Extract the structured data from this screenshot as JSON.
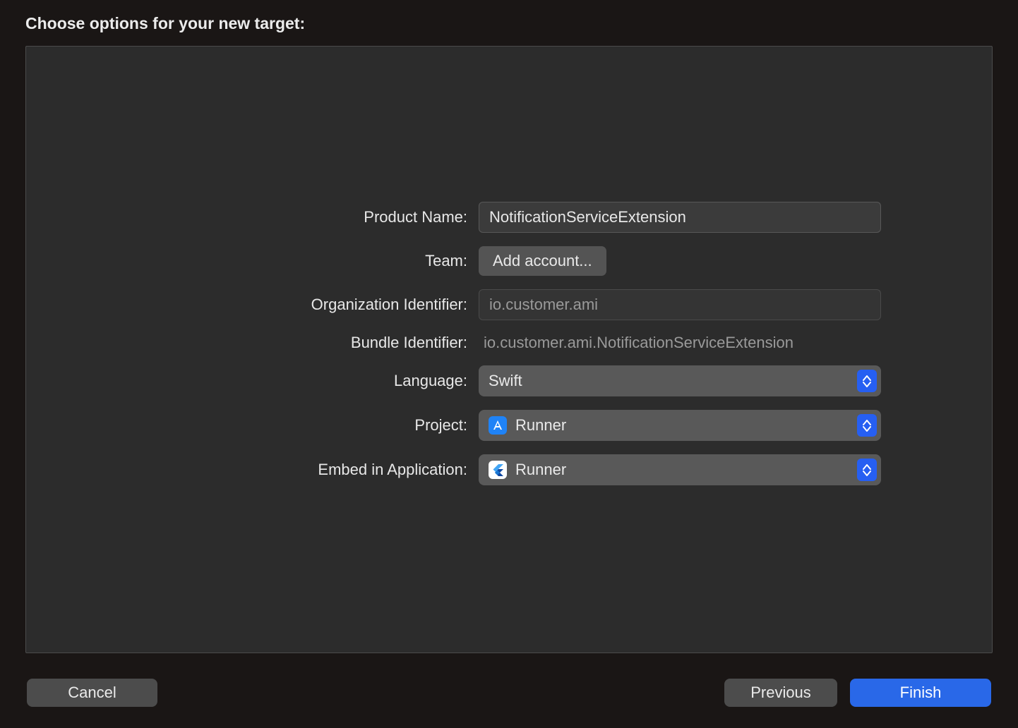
{
  "title": "Choose options for your new target:",
  "form": {
    "productName": {
      "label": "Product Name:",
      "value": "NotificationServiceExtension"
    },
    "team": {
      "label": "Team:",
      "buttonLabel": "Add account..."
    },
    "orgId": {
      "label": "Organization Identifier:",
      "value": "io.customer.ami"
    },
    "bundleId": {
      "label": "Bundle Identifier:",
      "value": "io.customer.ami.NotificationServiceExtension"
    },
    "language": {
      "label": "Language:",
      "value": "Swift"
    },
    "project": {
      "label": "Project:",
      "value": "Runner",
      "icon": "xcode-project-icon"
    },
    "embed": {
      "label": "Embed in Application:",
      "value": "Runner",
      "icon": "flutter-app-icon"
    }
  },
  "buttons": {
    "cancel": "Cancel",
    "previous": "Previous",
    "finish": "Finish"
  }
}
